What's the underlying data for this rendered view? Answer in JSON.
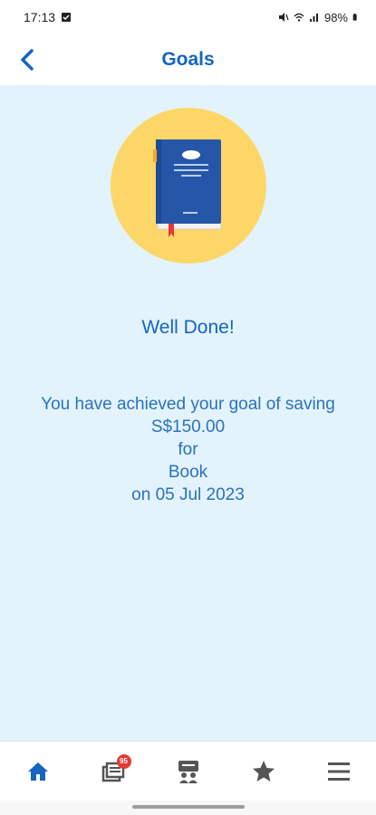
{
  "status_bar": {
    "time": "17:13",
    "battery": "98%"
  },
  "header": {
    "title": "Goals"
  },
  "main": {
    "heading": "Well Done!",
    "message_lines": [
      "You have achieved your goal of saving",
      "S$150.00",
      "for",
      "Book",
      "on 05 Jul 2023"
    ],
    "illustration": "book-icon"
  },
  "bottom_nav": {
    "items": [
      {
        "icon": "home-icon",
        "active": true
      },
      {
        "icon": "news-icon",
        "badge": "95"
      },
      {
        "icon": "community-icon"
      },
      {
        "icon": "star-icon"
      },
      {
        "icon": "menu-icon"
      }
    ]
  },
  "colors": {
    "accent": "#1565c0",
    "content_bg": "#e3f3fc",
    "circle": "#fdd668",
    "book": "#2656a8"
  }
}
